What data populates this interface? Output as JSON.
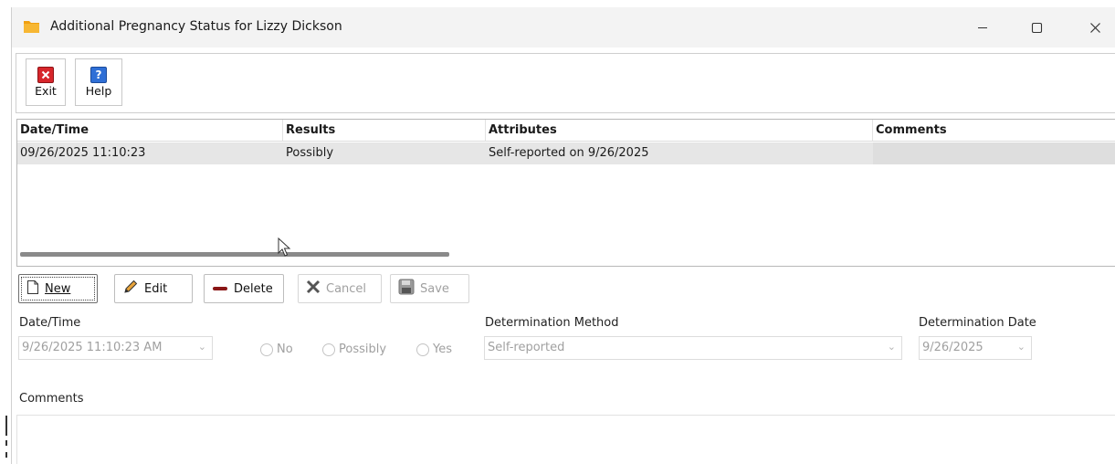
{
  "window": {
    "title": "Additional Pregnancy Status for Lizzy Dickson",
    "controls": {
      "minimize": "minimize",
      "maximize": "maximize",
      "close": "close"
    }
  },
  "toolbar": {
    "exit_label": "Exit",
    "help_label": "Help"
  },
  "grid": {
    "columns": [
      "Date/Time",
      "Results",
      "Attributes",
      "Comments"
    ],
    "rows": [
      {
        "datetime": "09/26/2025 11:10:23",
        "results": "Possibly",
        "attributes": "Self-reported on 9/26/2025",
        "comments": ""
      }
    ]
  },
  "actions": {
    "new_label": "New",
    "edit_label": "Edit",
    "delete_label": "Delete",
    "cancel_label": "Cancel",
    "save_label": "Save"
  },
  "form": {
    "datetime_label": "Date/Time",
    "datetime_value": "9/26/2025 11:10:23 AM",
    "result_options": [
      "No",
      "Possibly",
      "Yes"
    ],
    "method_label": "Determination Method",
    "method_value": "Self-reported",
    "date_label": "Determination Date",
    "date_value": "9/26/2025",
    "comments_label": "Comments"
  },
  "icons": {
    "exit": "exit-icon",
    "help": "help-icon",
    "new": "new-document-icon",
    "edit": "pencil-icon",
    "delete": "minus-icon",
    "cancel": "x-icon",
    "save": "floppy-disk-icon",
    "app": "folder-icon"
  },
  "colors": {
    "exit_red": "#d7262b",
    "help_blue": "#2f6fd6",
    "folder_orange": "#f0a010",
    "selected_row": "#e6e6e6",
    "disabled_text": "#a0a0a0"
  }
}
